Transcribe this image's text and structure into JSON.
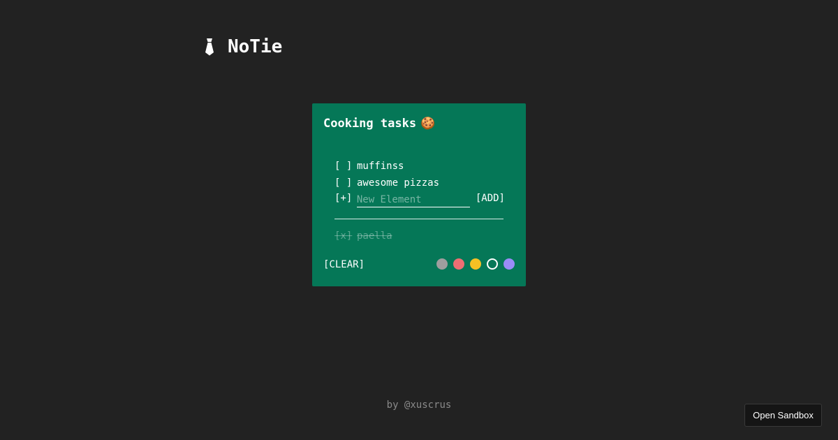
{
  "app": {
    "title": "NoTie",
    "icon": "tie-icon"
  },
  "note": {
    "title": "Cooking tasks",
    "title_emoji": "🍪",
    "background": "#057757",
    "pending": [
      {
        "check": "[ ]",
        "text": "muffinss"
      },
      {
        "check": "[ ]",
        "text": "awesome pizzas"
      }
    ],
    "new_item": {
      "prefix": "[+]",
      "placeholder": "New Element",
      "value": "",
      "add_label": "[ADD]"
    },
    "done": [
      {
        "check": "[x]",
        "text": "paella"
      }
    ],
    "clear_label": "[CLEAR]",
    "colors": [
      {
        "name": "gray",
        "hex": "#9e9e9e",
        "selected": false
      },
      {
        "name": "red",
        "hex": "#ee6e73",
        "selected": false
      },
      {
        "name": "yellow",
        "hex": "#f5c024",
        "selected": false
      },
      {
        "name": "green",
        "hex": "#057757",
        "selected": true
      },
      {
        "name": "purple",
        "hex": "#9a8cf7",
        "selected": false
      }
    ]
  },
  "footer": {
    "credit": "by @xuscrus"
  },
  "sandbox": {
    "label": "Open Sandbox"
  }
}
